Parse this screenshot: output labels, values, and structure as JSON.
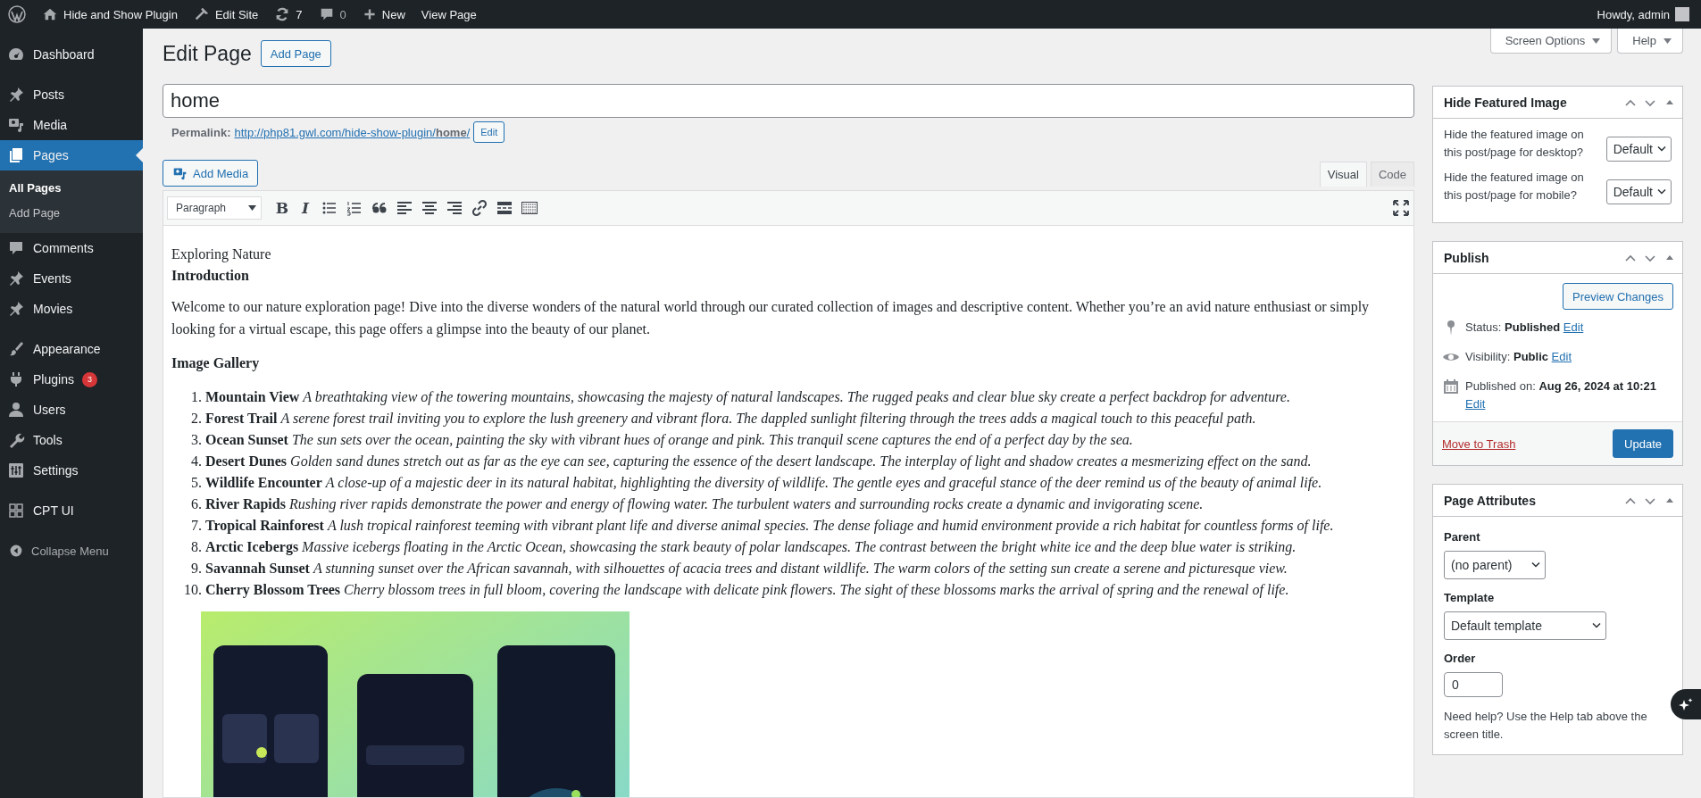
{
  "admin_bar": {
    "site": "Hide and Show Plugin",
    "edit_site": "Edit Site",
    "updates": "7",
    "comments": "0",
    "new": "New",
    "view": "View Page",
    "greeting": "Howdy, admin"
  },
  "sidebar": {
    "items": [
      {
        "label": "Dashboard",
        "selected": false
      },
      {
        "label": "Posts",
        "selected": false
      },
      {
        "label": "Media",
        "selected": false
      },
      {
        "label": "Pages",
        "selected": true,
        "children": [
          {
            "label": "All Pages",
            "selected": true
          },
          {
            "label": "Add Page",
            "selected": false
          }
        ]
      },
      {
        "label": "Comments",
        "selected": false
      },
      {
        "label": "Events",
        "selected": false
      },
      {
        "label": "Movies",
        "selected": false
      },
      {
        "label": "Appearance",
        "selected": false
      },
      {
        "label": "Plugins",
        "selected": false,
        "badge": "3"
      },
      {
        "label": "Users",
        "selected": false
      },
      {
        "label": "Tools",
        "selected": false
      },
      {
        "label": "Settings",
        "selected": false
      },
      {
        "label": "CPT UI",
        "selected": false
      }
    ],
    "collapse": "Collapse Menu"
  },
  "screen_buttons": [
    "Screen Options",
    "Help"
  ],
  "heading": "Edit Page",
  "add_page": "Add Page",
  "title_field": {
    "value": "home"
  },
  "permalink": {
    "label": "Permalink:",
    "url": "http://php81.gwl.com/hide-show-plugin/**home**/",
    "button": "Edit"
  },
  "add_media": "Add Media",
  "editor_tabs": [
    {
      "label": "Visual",
      "selected": true
    },
    {
      "label": "Code",
      "selected": false
    }
  ],
  "toolbar": {
    "format": "Paragraph",
    "bold": "B",
    "italic": "I"
  },
  "content": {
    "heading": "Exploring Nature",
    "subheading": "Introduction",
    "intro": "Welcome to our nature exploration page! Dive into the diverse wonders of the natural world through our curated collection of images and descriptive content. Whether you’re an avid nature enthusiast or simply looking for a virtual escape, this page offers a glimpse into the beauty of our planet.",
    "gallery_heading": "Image Gallery",
    "items": [
      {
        "number": "1.",
        "title": "Mountain View",
        "text": "A breathtaking view of the towering mountains, showcasing the majesty of natural landscapes. The rugged peaks and clear blue sky create a perfect backdrop for adventure."
      },
      {
        "number": "2.",
        "title": "Forest Trail",
        "text": "A serene forest trail inviting you to explore the lush greenery and vibrant flora. The dappled sunlight filtering through the trees adds a magical touch to this peaceful path."
      },
      {
        "number": "3.",
        "title": "Ocean Sunset",
        "text": "The sun sets over the ocean, painting the sky with vibrant hues of orange and pink. This tranquil scene captures the end of a perfect day by the sea."
      },
      {
        "number": "4.",
        "title": "Desert Dunes",
        "text": "Golden sand dunes stretch out as far as the eye can see, capturing the essence of the desert landscape. The interplay of light and shadow creates a mesmerizing effect on the sand."
      },
      {
        "number": "5.",
        "title": "Wildlife Encounter",
        "text": "A close-up of a majestic deer in its natural habitat, highlighting the diversity of wildlife. The gentle eyes and graceful stance of the deer remind us of the beauty of animal life."
      },
      {
        "number": "6.",
        "title": "River Rapids",
        "text": "Rushing river rapids demonstrate the power and energy of flowing water. The turbulent waters and surrounding rocks create a dynamic and invigorating scene."
      },
      {
        "number": "7.",
        "title": "Tropical Rainforest",
        "text": "A lush tropical rainforest teeming with vibrant plant life and diverse animal species. The dense foliage and humid environment provide a rich habitat for countless forms of life."
      },
      {
        "number": "8.",
        "title": "Arctic Icebergs",
        "text": "Massive icebergs floating in the Arctic Ocean, showcasing the stark beauty of polar landscapes. The contrast between the bright white ice and the deep blue water is striking."
      },
      {
        "number": "9.",
        "title": "Savannah Sunset",
        "text": "A stunning sunset over the African savannah, with silhouettes of acacia trees and distant wildlife. The warm colors of the setting sun create a serene and picturesque view."
      },
      {
        "number": "10.",
        "title": "Cherry Blossom Trees",
        "text": "Cherry blossom trees in full bloom, covering the landscape with delicate pink flowers. The sight of these blossoms marks the arrival of spring and the renewal of life."
      }
    ]
  },
  "hide_featured_image": {
    "title": "Hide Featured Image",
    "fields": [
      {
        "label": "Hide the featured image on this post/page for desktop?",
        "value": "Default"
      },
      {
        "label": "Hide the featured image on this post/page for mobile?",
        "value": "Default"
      }
    ]
  },
  "publish": {
    "title": "Publish",
    "preview": "Preview Changes",
    "rows": [
      {
        "label": "Status:",
        "value": "Published",
        "link": "Edit"
      },
      {
        "label": "Visibility:",
        "value": "Public",
        "link": "Edit"
      },
      {
        "label": "Published on:",
        "value": "Aug 26, 2024 at 10:21",
        "link": "Edit"
      }
    ],
    "trash": "Move to Trash",
    "update": "Update"
  },
  "page_attributes": {
    "title": "Page Attributes",
    "parent_label": "Parent",
    "parent": "(no parent)",
    "template_label": "Template",
    "template": "Default template",
    "order_label": "Order",
    "order": "0",
    "help": "Need help? Use the Help tab above the screen title."
  }
}
